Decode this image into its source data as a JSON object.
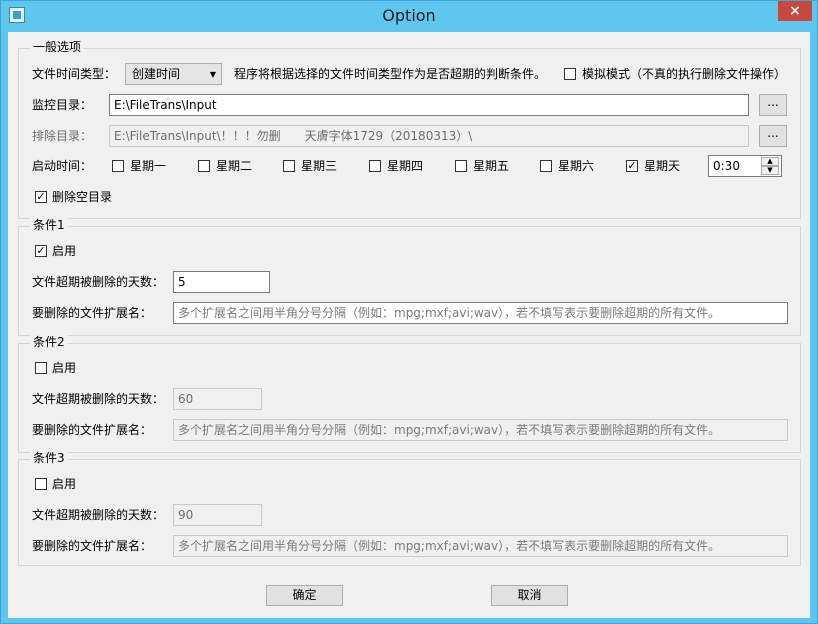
{
  "window": {
    "title": "Option",
    "close_symbol": "×",
    "app_icon": "app-icon",
    "colors": {
      "titlebar": "#5fc7ee",
      "close": "#c7483f",
      "client": "#f0f0f0"
    }
  },
  "general": {
    "legend": "一般选项",
    "time_type_label": "文件时间类型：",
    "time_type_value": "创建时间",
    "time_type_hint": "程序将根据选择的文件时间类型作为是否超期的判断条件。",
    "simulate_checked": false,
    "simulate_label": "模拟模式（不真的执行删除文件操作）",
    "monitor_label": "监控目录：",
    "monitor_value": "E:\\FileTrans\\Input",
    "exclude_label": "排除目录：",
    "exclude_value": "E:\\FileTrans\\Input\\！！！勿删　　天膚字体1729（20180313）\\",
    "browse_label": "...",
    "start_time_label": "启动时间：",
    "weekdays": [
      {
        "label": "星期一",
        "checked": false
      },
      {
        "label": "星期二",
        "checked": false
      },
      {
        "label": "星期三",
        "checked": false
      },
      {
        "label": "星期四",
        "checked": false
      },
      {
        "label": "星期五",
        "checked": false
      },
      {
        "label": "星期六",
        "checked": false
      },
      {
        "label": "星期天",
        "checked": true
      }
    ],
    "start_time_value": "0:30",
    "delete_empty_checked": true,
    "delete_empty_label": "删除空目录"
  },
  "conditions": [
    {
      "legend": "条件1",
      "enabled": true,
      "enable_label": "启用",
      "days_label": "文件超期被删除的天数：",
      "days_value": "5",
      "ext_label": "要删除的文件扩展名：",
      "ext_placeholder": "多个扩展名之间用半角分号分隔（例如：mpg;mxf;avi;wav），若不填写表示要删除超期的所有文件。"
    },
    {
      "legend": "条件2",
      "enabled": false,
      "enable_label": "启用",
      "days_label": "文件超期被删除的天数：",
      "days_value": "60",
      "ext_label": "要删除的文件扩展名：",
      "ext_placeholder": "多个扩展名之间用半角分号分隔（例如：mpg;mxf;avi;wav），若不填写表示要删除超期的所有文件。"
    },
    {
      "legend": "条件3",
      "enabled": false,
      "enable_label": "启用",
      "days_label": "文件超期被删除的天数：",
      "days_value": "90",
      "ext_label": "要删除的文件扩展名：",
      "ext_placeholder": "多个扩展名之间用半角分号分隔（例如：mpg;mxf;avi;wav），若不填写表示要删除超期的所有文件。"
    }
  ],
  "footer": {
    "ok_label": "确定",
    "cancel_label": "取消"
  },
  "glyphs": {
    "check": "✓",
    "dropdown": "▼",
    "spin_up": "▲",
    "spin_down": "▼"
  }
}
